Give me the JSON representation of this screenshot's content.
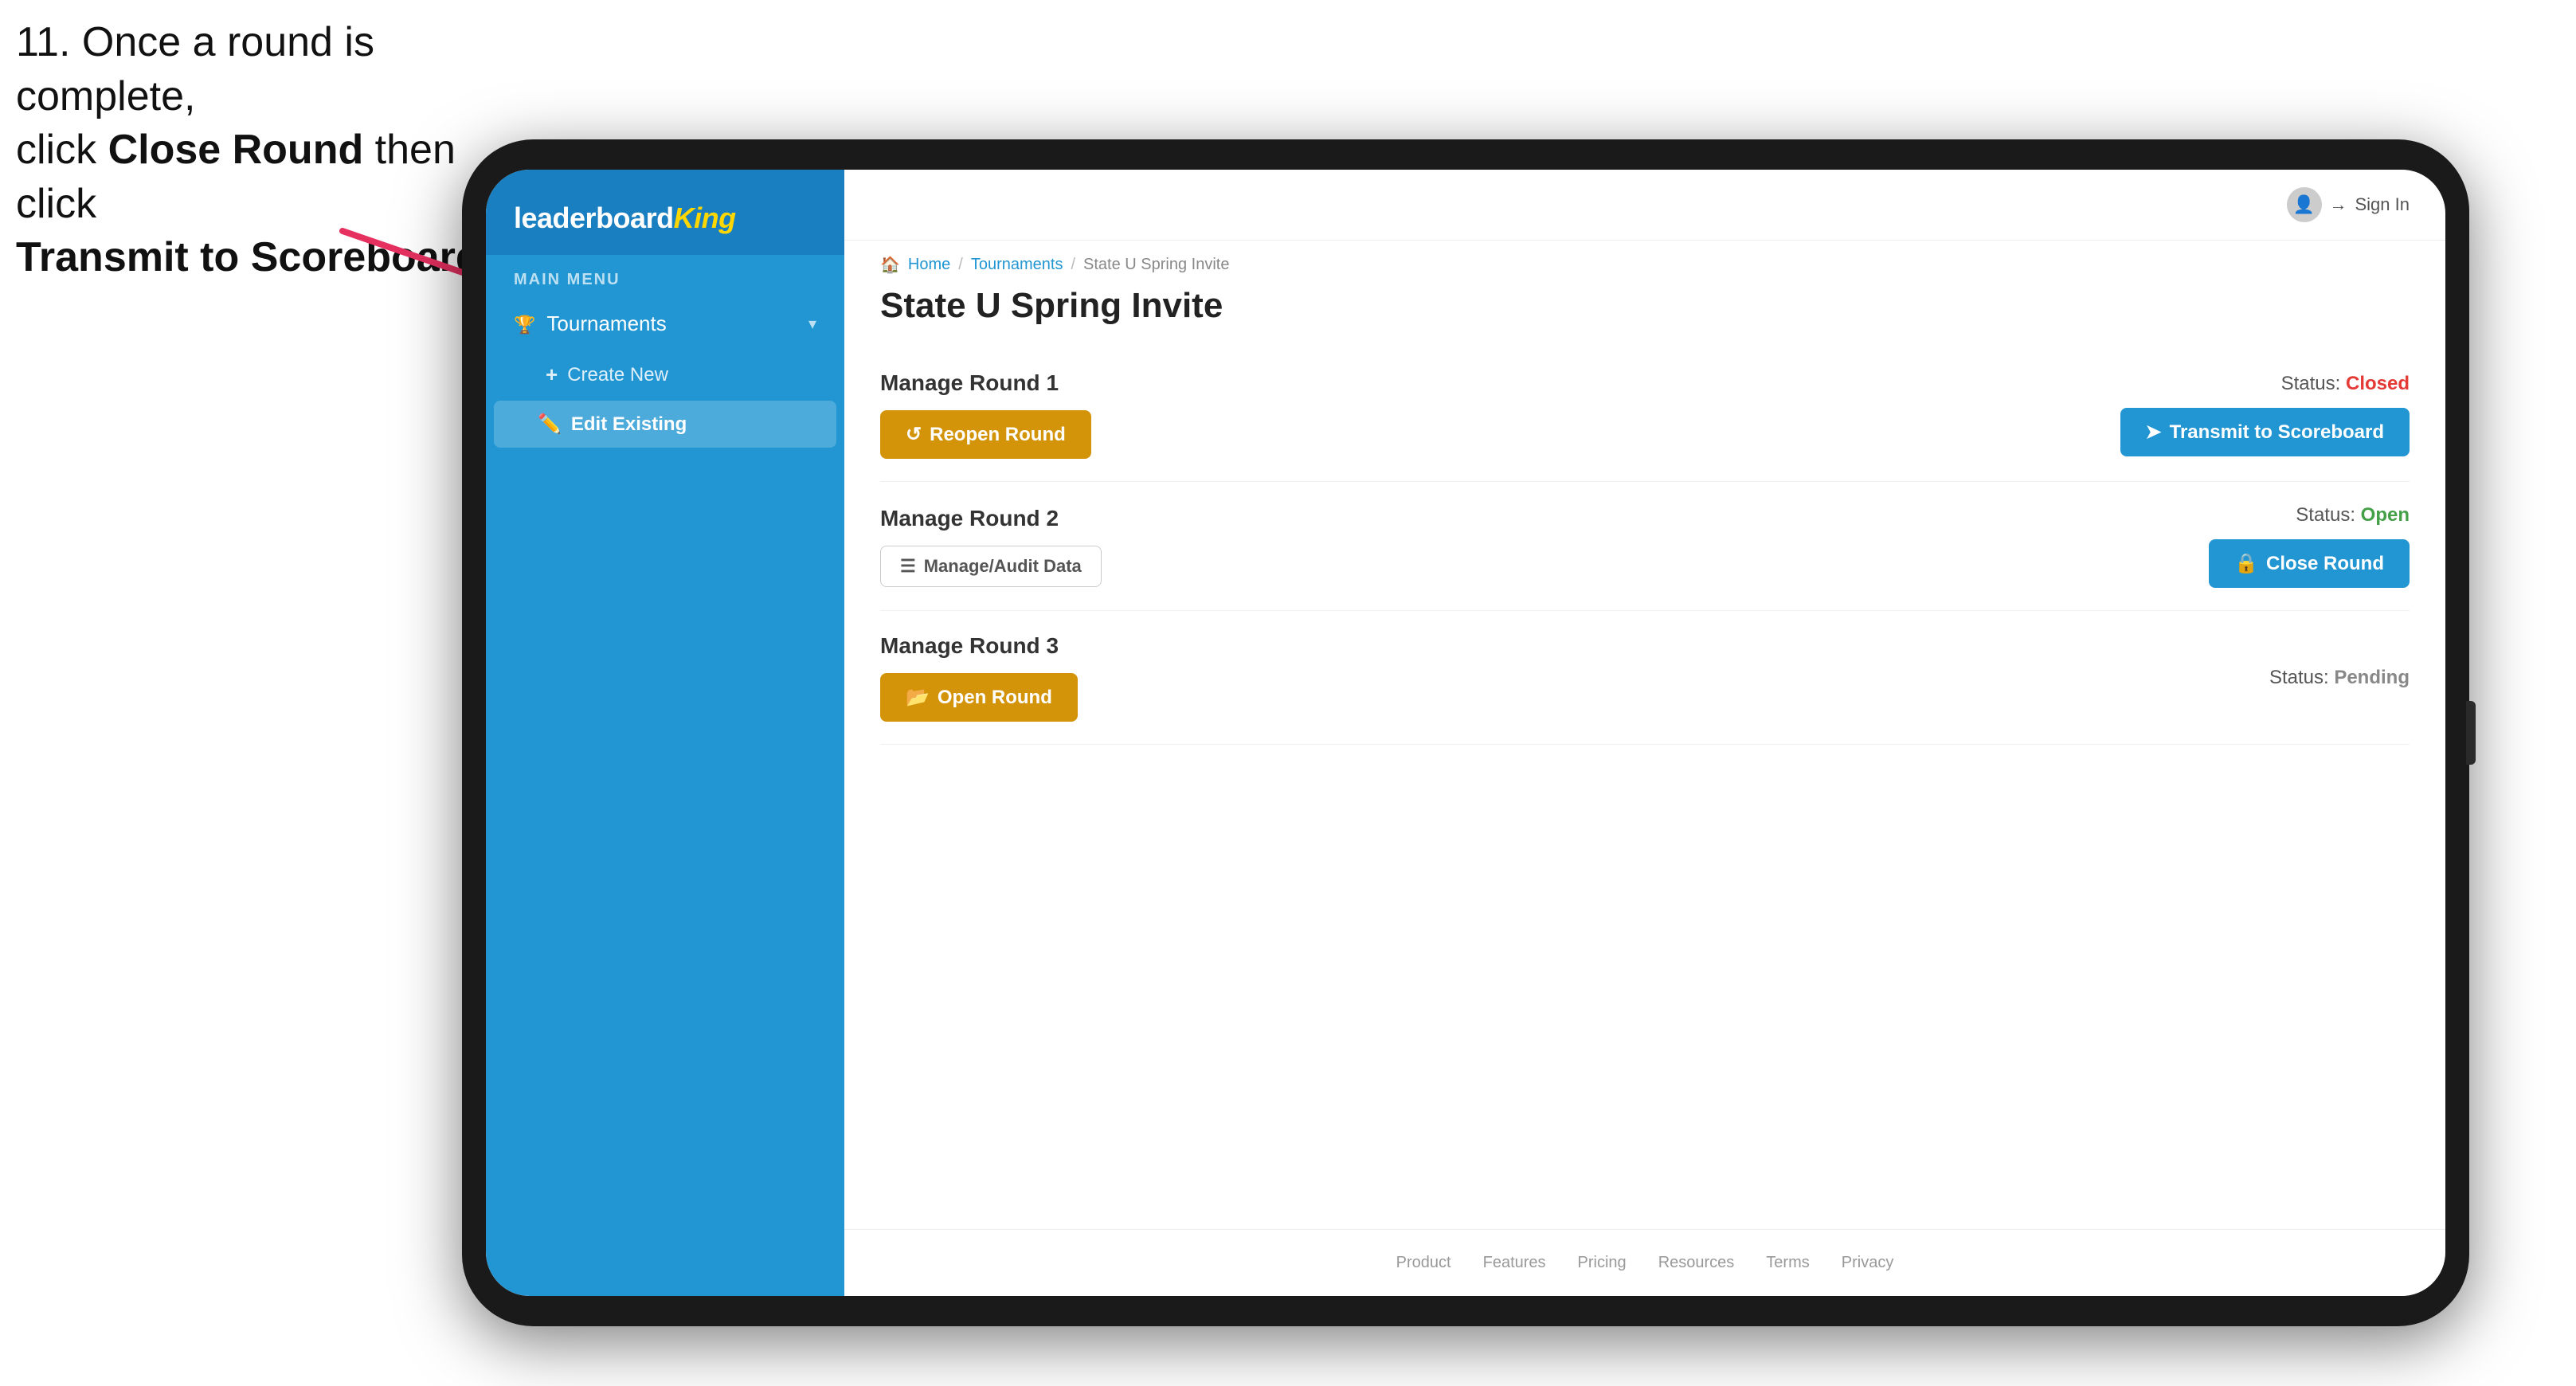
{
  "instruction": {
    "line1": "11. Once a round is complete,",
    "line2": "click ",
    "bold1": "Close Round",
    "line3": " then click",
    "bold2": "Transmit to Scoreboard."
  },
  "sidebar": {
    "logo": "leaderboard",
    "logo_king": "King",
    "main_menu_label": "MAIN MENU",
    "tournaments_label": "Tournaments",
    "create_new_label": "Create New",
    "edit_existing_label": "Edit Existing"
  },
  "topbar": {
    "sign_in_label": "Sign In"
  },
  "breadcrumb": {
    "home": "Home",
    "separator1": "/",
    "tournaments": "Tournaments",
    "separator2": "/",
    "current": "State U Spring Invite"
  },
  "page": {
    "title": "State U Spring Invite",
    "round1": {
      "label": "Manage Round 1",
      "status_prefix": "Status: ",
      "status": "Closed",
      "status_class": "status-closed",
      "btn1_label": "Reopen Round",
      "btn2_label": "Transmit to Scoreboard"
    },
    "round2": {
      "label": "Manage Round 2",
      "status_prefix": "Status: ",
      "status": "Open",
      "status_class": "status-open",
      "btn1_label": "Manage/Audit Data",
      "btn2_label": "Close Round"
    },
    "round3": {
      "label": "Manage Round 3",
      "status_prefix": "Status: ",
      "status": "Pending",
      "status_class": "status-pending",
      "btn1_label": "Open Round"
    }
  },
  "footer": {
    "links": [
      "Product",
      "Features",
      "Pricing",
      "Resources",
      "Terms",
      "Privacy"
    ]
  },
  "colors": {
    "sidebar_bg": "#2196d3",
    "btn_yellow": "#d4940a",
    "btn_blue": "#2196d3",
    "status_closed": "#e53935",
    "status_open": "#43a047"
  }
}
